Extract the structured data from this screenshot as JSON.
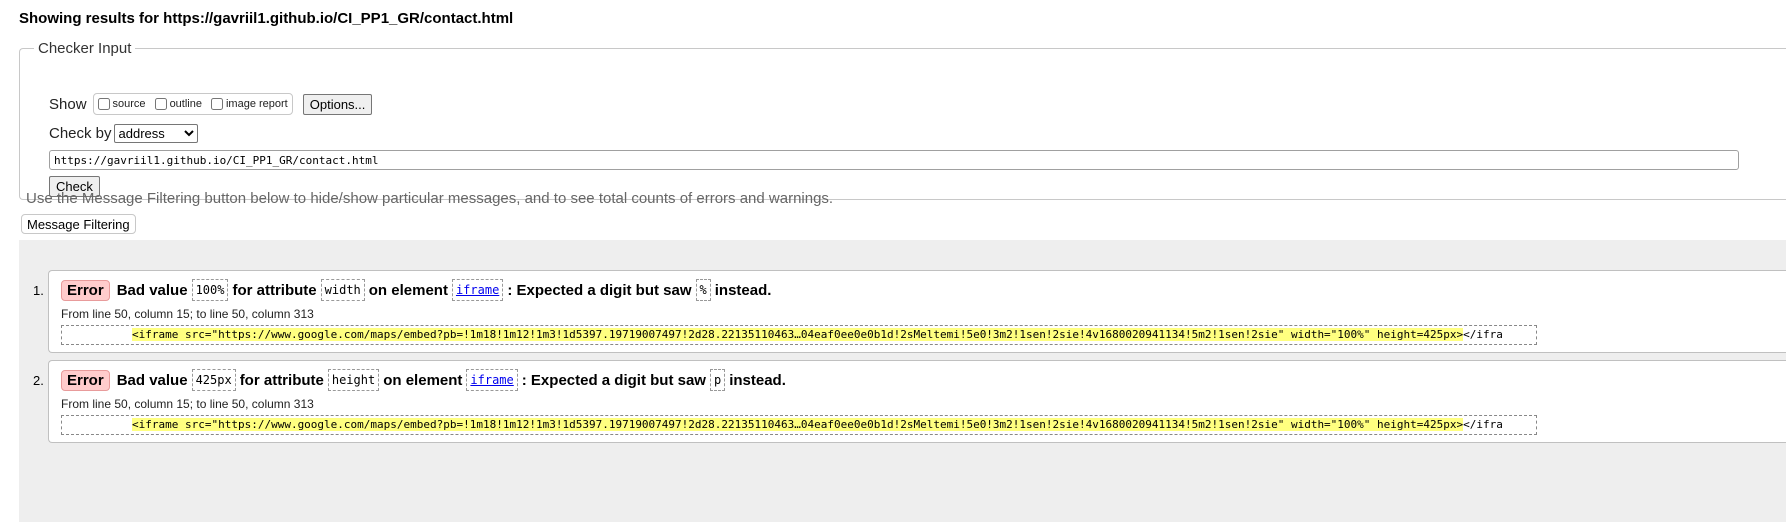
{
  "heading": "Showing results for https://gavriil1.github.io/CI_PP1_GR/contact.html",
  "checker": {
    "legend": "Checker Input",
    "show_label": "Show",
    "options": [
      {
        "label": "source",
        "checked": false
      },
      {
        "label": "outline",
        "checked": false
      },
      {
        "label": "image report",
        "checked": false
      }
    ],
    "options_button": "Options...",
    "check_by_label": "Check by",
    "check_by_selected": "address",
    "url_value": "https://gavriil1.github.io/CI_PP1_GR/contact.html",
    "check_button": "Check"
  },
  "filter_note": "Use the Message Filtering button below to hide/show particular messages, and to see total counts of errors and warnings.",
  "filter_button": "Message Filtering",
  "messages": [
    {
      "num": "1.",
      "type": "Error",
      "t1": "Bad value",
      "code1": "100%",
      "t2": "for attribute",
      "code2": "width",
      "t3": "on element",
      "element": "iframe",
      "t4": ": Expected a digit but saw",
      "code3": "%",
      "t5": "instead.",
      "location": "From line 50, column 15; to line 50, column 313",
      "extract_highlight": "<iframe src=\"https://www.google.com/maps/embed?pb=!1m18!1m12!1m3!1d5397.19719007497!2d28.22135110463…04eaf0ee0e0b1d!2sMeltemi!5e0!3m2!1sen!2sie!4v1680020941134!5m2!1sen!2sie\" width=\"100%\" height=425px>",
      "extract_after": "</ifra"
    },
    {
      "num": "2.",
      "type": "Error",
      "t1": "Bad value",
      "code1": "425px",
      "t2": "for attribute",
      "code2": "height",
      "t3": "on element",
      "element": "iframe",
      "t4": ": Expected a digit but saw",
      "code3": "p",
      "t5": "instead.",
      "location": "From line 50, column 15; to line 50, column 313",
      "extract_highlight": "<iframe src=\"https://www.google.com/maps/embed?pb=!1m18!1m12!1m3!1d5397.19719007497!2d28.22135110463…04eaf0ee0e0b1d!2sMeltemi!5e0!3m2!1sen!2sie!4v1680020941134!5m2!1sen!2sie\" width=\"100%\" height=425px>",
      "extract_after": "</ifra"
    }
  ],
  "colors": {
    "error_badge_bg": "#ffcccc",
    "highlight_bg": "#ffff80",
    "results_bg": "#eeeeee",
    "link": "#0000ee"
  }
}
